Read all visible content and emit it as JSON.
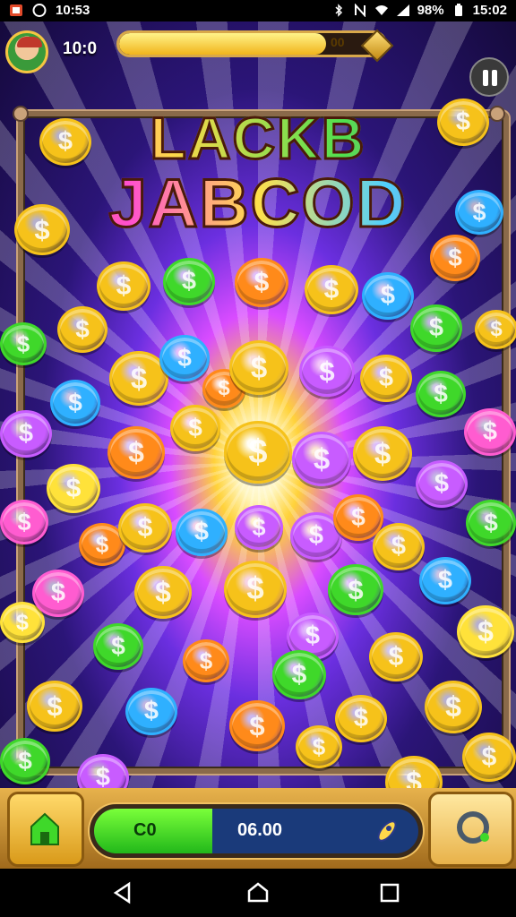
{
  "status_bar": {
    "left_time": "10:53",
    "battery_percent": "98%",
    "clock": "15:02"
  },
  "header": {
    "score": "10:0",
    "progress_label": "00",
    "progress_fraction": 0.78
  },
  "title": {
    "line1": "LACKB",
    "line2": "JABCOD"
  },
  "hud": {
    "balance_left": "C0",
    "balance_right": "06.00"
  },
  "coin_colors": {
    "gold": "#f6c21a",
    "green": "#3fd82a",
    "blue": "#2fb0ff",
    "purple": "#c85cff",
    "pink": "#ff5cd0",
    "orange": "#ff8a1a",
    "yellow": "#ffe23a"
  },
  "icons": {
    "pause": "pause-icon",
    "home": "home-icon",
    "refresh": "refresh-icon",
    "back": "back-triangle-icon",
    "nav_home": "home-circle-icon",
    "recents": "recents-square-icon"
  }
}
